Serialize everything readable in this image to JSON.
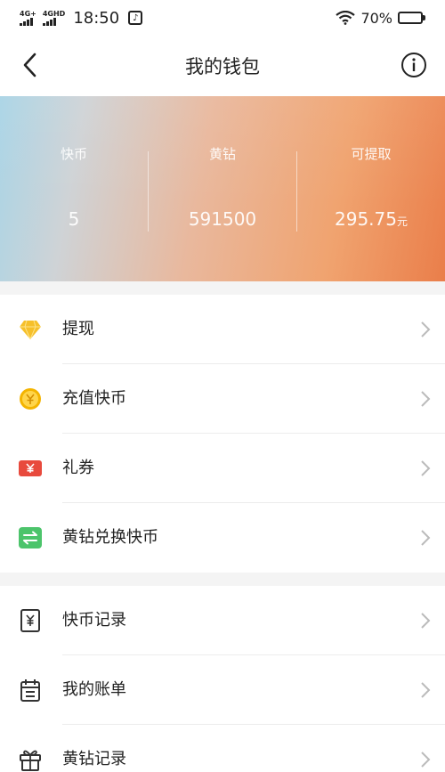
{
  "status_bar": {
    "network1": "4G+",
    "network2": "4GHD",
    "time": "18:50",
    "music_glyph": "♪",
    "battery": "70%",
    "battery_level": 0.7
  },
  "header": {
    "title": "我的钱包",
    "back_icon": "chevron-left-icon",
    "info_icon": "info-icon"
  },
  "banner": {
    "stats": [
      {
        "label": "快币",
        "value": "5",
        "unit": ""
      },
      {
        "label": "黄钻",
        "value": "591500",
        "unit": ""
      },
      {
        "label": "可提取",
        "value": "295.75",
        "unit": "元"
      }
    ]
  },
  "menu_group_1": [
    {
      "label": "提现",
      "icon": "diamond-icon"
    },
    {
      "label": "充值快币",
      "icon": "coin-icon"
    },
    {
      "label": "礼券",
      "icon": "coupon-icon"
    },
    {
      "label": "黄钻兑换快币",
      "icon": "exchange-icon"
    }
  ],
  "menu_group_2": [
    {
      "label": "快币记录",
      "icon": "yuan-doc-icon"
    },
    {
      "label": "我的账单",
      "icon": "calendar-bill-icon"
    },
    {
      "label": "黄钻记录",
      "icon": "gift-icon"
    }
  ],
  "colors": {
    "banner_start": "#a9d4e6",
    "banner_end": "#ea7e4a",
    "diamond": "#f6c02a",
    "coupon": "#e84a3d",
    "exchange": "#4cc46b"
  }
}
